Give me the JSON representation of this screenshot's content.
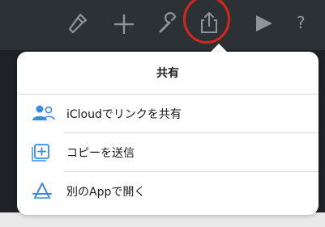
{
  "share_popover": {
    "title": "共有",
    "items": [
      {
        "label": "iCloudでリンクを共有",
        "icon": "icloud-share-people-icon"
      },
      {
        "label": "コピーを送信",
        "icon": "send-copy-icon"
      },
      {
        "label": "別のAppで開く",
        "icon": "app-store-icon"
      }
    ]
  },
  "toolbar": {
    "icons": [
      "format-brush-icon",
      "add-icon",
      "wrench-icon",
      "share-icon",
      "play-icon",
      "help-icon"
    ],
    "help_label": "?"
  },
  "colors": {
    "toolbar_bg": "#2c3136",
    "accent": "#3a8be6",
    "highlight_circle": "#d9271c"
  }
}
